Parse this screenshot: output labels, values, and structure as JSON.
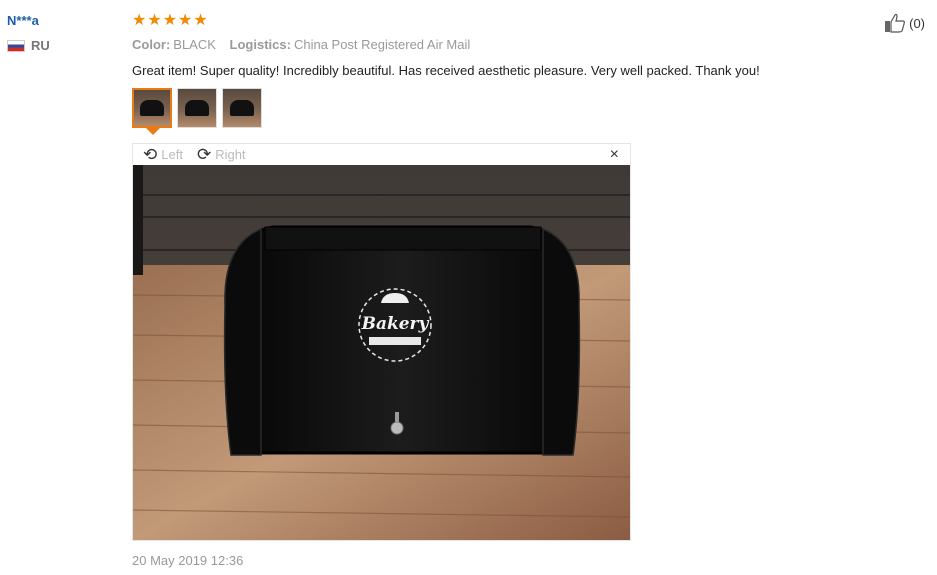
{
  "user": {
    "name": "N***a",
    "country": "RU"
  },
  "review": {
    "stars": 5,
    "color_label": "Color:",
    "color_value": "BLACK",
    "logistics_label": "Logistics:",
    "logistics_value": "China Post Registered Air Mail",
    "text": "Great item! Super quality! Incredibly beautiful. Has received aesthetic pleasure. Very well packed. Thank you!",
    "date": "20 May 2019 12:36",
    "thumbnail_count": 3,
    "selected_thumbnail": 1
  },
  "viewer": {
    "rotate_left": "Left",
    "rotate_right": "Right",
    "close": "×"
  },
  "photo": {
    "logo_text": "Bakery"
  },
  "helpful": {
    "count": "(0)"
  },
  "colors": {
    "username": "#1f5fa8",
    "stars": "#f28a00",
    "active_thumb_border": "#e87a18"
  },
  "icons": [
    "flag-icon",
    "star-icon",
    "rotate-left-icon",
    "rotate-right-icon",
    "close-icon",
    "thumbs-up-icon"
  ]
}
